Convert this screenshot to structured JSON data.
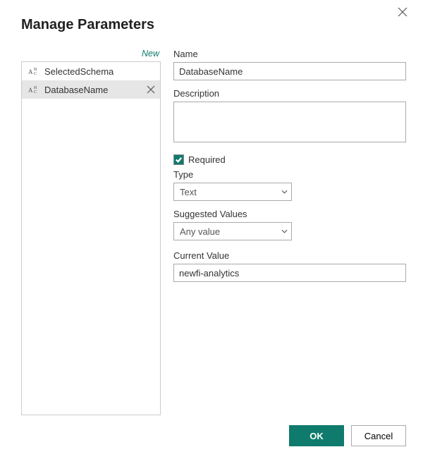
{
  "dialog": {
    "title": "Manage Parameters"
  },
  "sidebar": {
    "new_label": "New",
    "items": [
      {
        "label": "SelectedSchema",
        "selected": false
      },
      {
        "label": "DatabaseName",
        "selected": true
      }
    ]
  },
  "form": {
    "name_label": "Name",
    "name_value": "DatabaseName",
    "description_label": "Description",
    "description_value": "",
    "required_label": "Required",
    "required_checked": true,
    "type_label": "Type",
    "type_value": "Text",
    "suggested_label": "Suggested Values",
    "suggested_value": "Any value",
    "current_label": "Current Value",
    "current_value": "newfi-analytics"
  },
  "footer": {
    "ok_label": "OK",
    "cancel_label": "Cancel"
  }
}
